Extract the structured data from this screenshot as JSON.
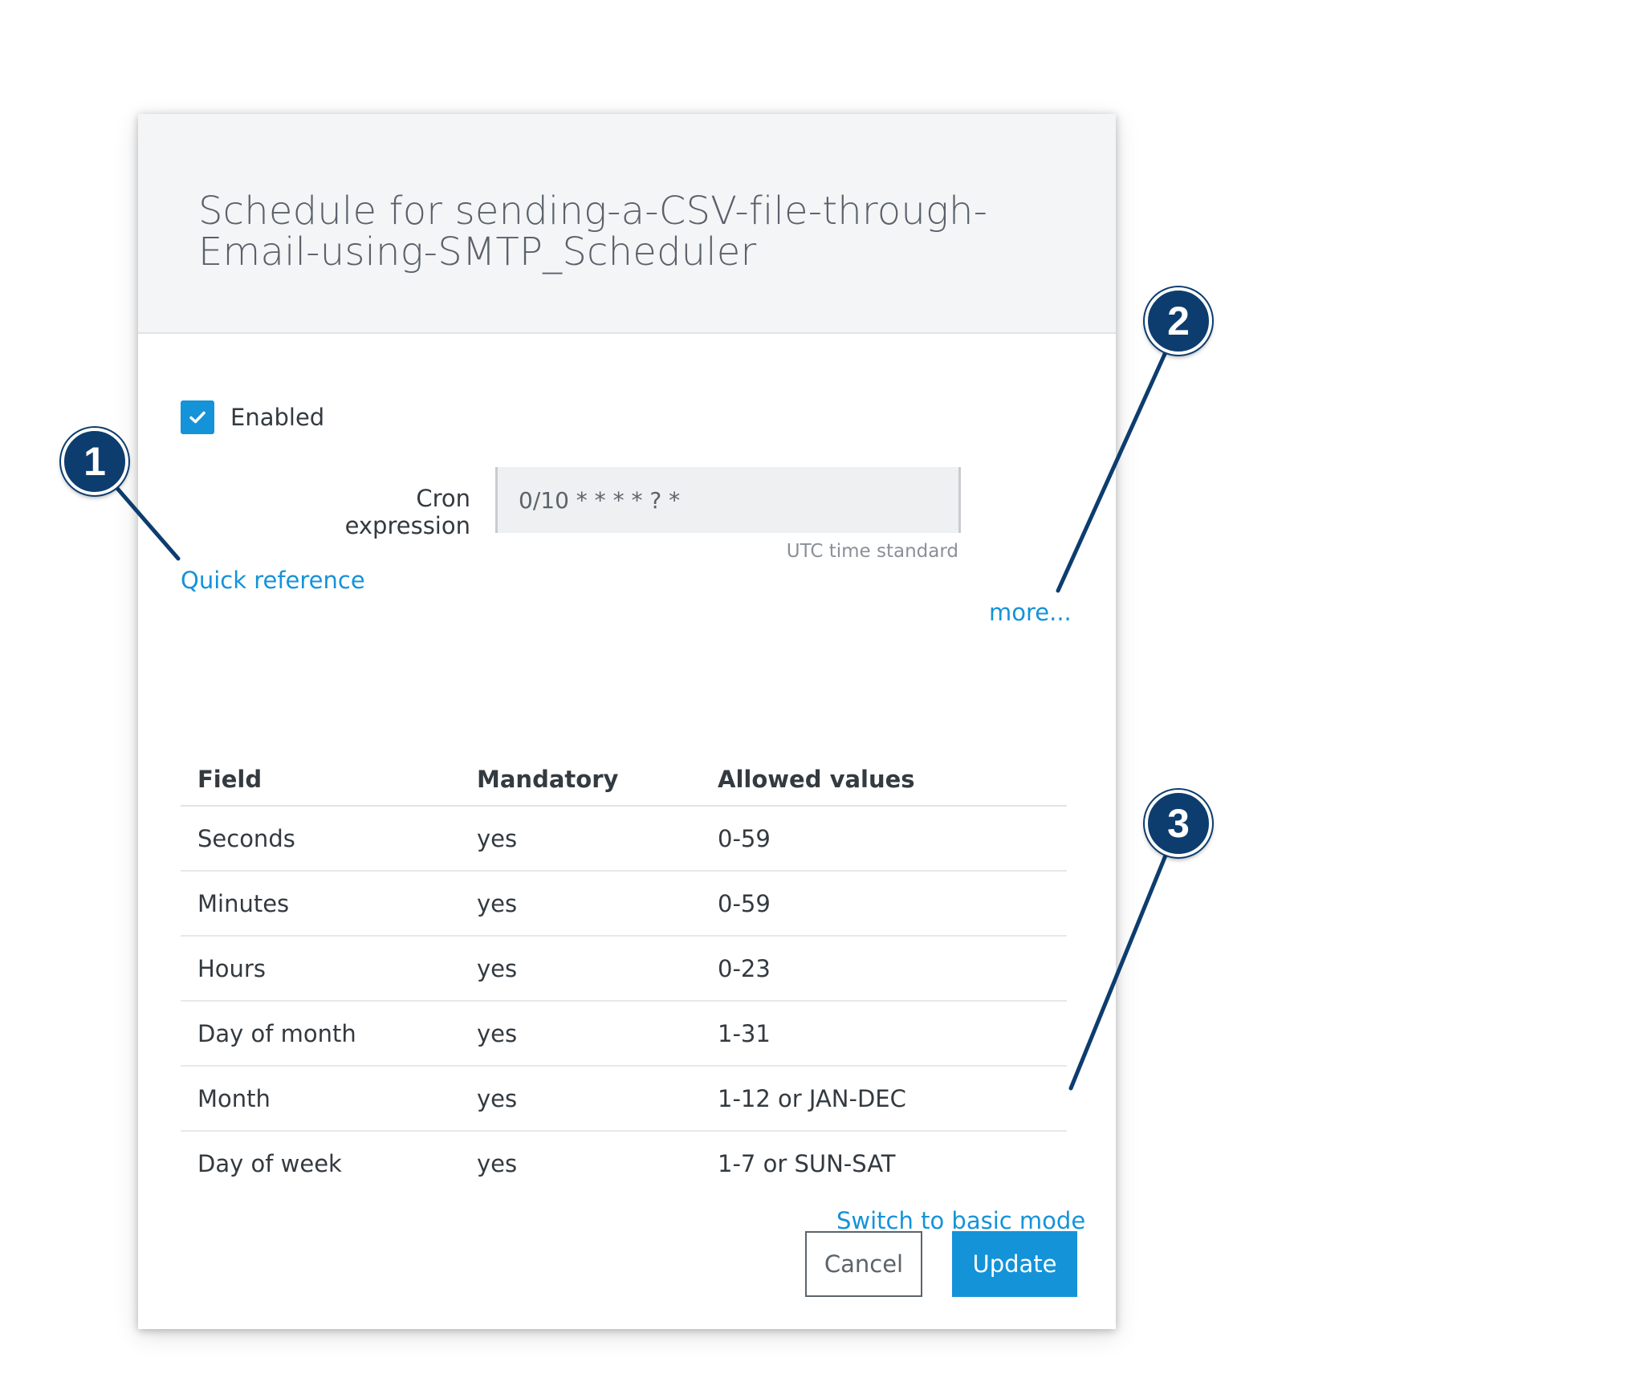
{
  "dialog": {
    "title_line1": "Schedule for sending-a-CSV-file-through-",
    "title_line2": "Email-using-SMTP_Scheduler",
    "enabled_label": "Enabled",
    "enabled_checked": true,
    "cron_label": "Cron expression",
    "cron_value": "0/10 * * * * ? *",
    "utc_note": "UTC time standard",
    "quick_reference_link": "Quick reference",
    "more_link": "more...",
    "switch_mode_link": "Switch to basic mode",
    "cancel_label": "Cancel",
    "update_label": "Update"
  },
  "table": {
    "headers": [
      "Field",
      "Mandatory",
      "Allowed values"
    ],
    "rows": [
      [
        "Seconds",
        "yes",
        "0-59"
      ],
      [
        "Minutes",
        "yes",
        "0-59"
      ],
      [
        "Hours",
        "yes",
        "0-23"
      ],
      [
        "Day of month",
        "yes",
        "1-31"
      ],
      [
        "Month",
        "yes",
        "1-12 or JAN-DEC"
      ],
      [
        "Day of week",
        "yes",
        "1-7 or SUN-SAT"
      ]
    ]
  },
  "callouts": [
    "1",
    "2",
    "3"
  ],
  "colors": {
    "accent": "#1493d9",
    "callout": "#0d3d6e",
    "header_bg": "#f4f5f6",
    "text": "#333a40"
  },
  "icons": {
    "checkbox": "checkmark-icon"
  }
}
